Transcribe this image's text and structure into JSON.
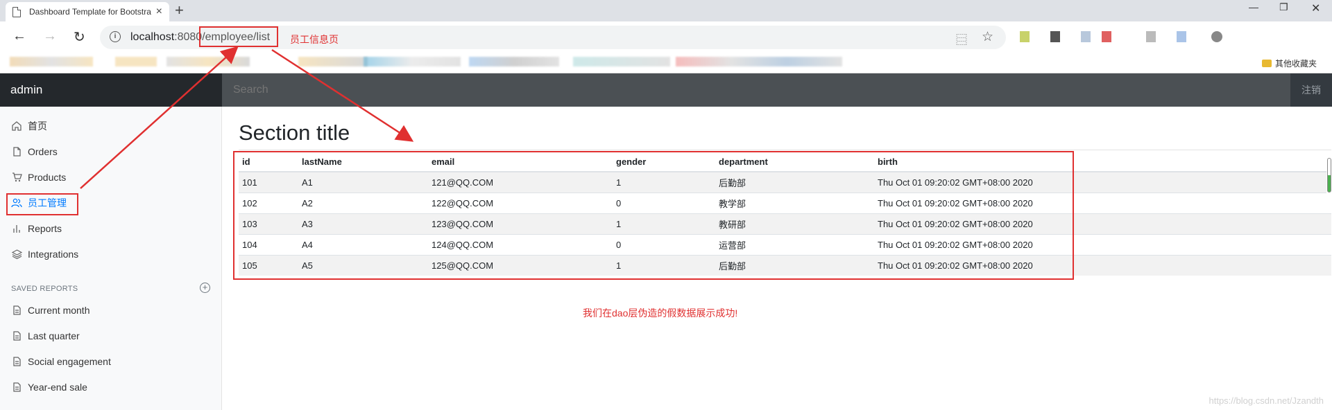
{
  "browser": {
    "tab_title": "Dashboard Template for Bootstra",
    "url_host": "localhost",
    "url_rest": ":8080/employee/list",
    "url_annotation": "员工信息页",
    "bookmark_folder": "其他收藏夹"
  },
  "header": {
    "brand": "admin",
    "search_placeholder": "Search",
    "signout": "注销"
  },
  "sidebar": {
    "items": [
      {
        "label": "首页",
        "icon": "home-icon"
      },
      {
        "label": "Orders",
        "icon": "file-icon"
      },
      {
        "label": "Products",
        "icon": "cart-icon"
      },
      {
        "label": "员工管理",
        "icon": "users-icon"
      },
      {
        "label": "Reports",
        "icon": "bar-chart-icon"
      },
      {
        "label": "Integrations",
        "icon": "layers-icon"
      }
    ],
    "saved_heading": "SAVED REPORTS",
    "saved_items": [
      {
        "label": "Current month"
      },
      {
        "label": "Last quarter"
      },
      {
        "label": "Social engagement"
      },
      {
        "label": "Year-end sale"
      }
    ]
  },
  "main": {
    "section_title": "Section title",
    "table": {
      "headers": [
        "id",
        "lastName",
        "email",
        "gender",
        "department",
        "birth"
      ],
      "rows": [
        [
          "101",
          "A1",
          "121@QQ.COM",
          "1",
          "后勤部",
          "Thu Oct 01 09:20:02 GMT+08:00 2020"
        ],
        [
          "102",
          "A2",
          "122@QQ.COM",
          "0",
          "教学部",
          "Thu Oct 01 09:20:02 GMT+08:00 2020"
        ],
        [
          "103",
          "A3",
          "123@QQ.COM",
          "1",
          "教研部",
          "Thu Oct 01 09:20:02 GMT+08:00 2020"
        ],
        [
          "104",
          "A4",
          "124@QQ.COM",
          "0",
          "运营部",
          "Thu Oct 01 09:20:02 GMT+08:00 2020"
        ],
        [
          "105",
          "A5",
          "125@QQ.COM",
          "1",
          "后勤部",
          "Thu Oct 01 09:20:02 GMT+08:00 2020"
        ]
      ]
    },
    "success_note": "我们在dao层伪造的假数据展示成功!",
    "watermark": "https://blog.csdn.net/Jzandth"
  },
  "colors": {
    "annotation_red": "#e03030",
    "active_blue": "#007bff",
    "topbar": "#343a40"
  }
}
